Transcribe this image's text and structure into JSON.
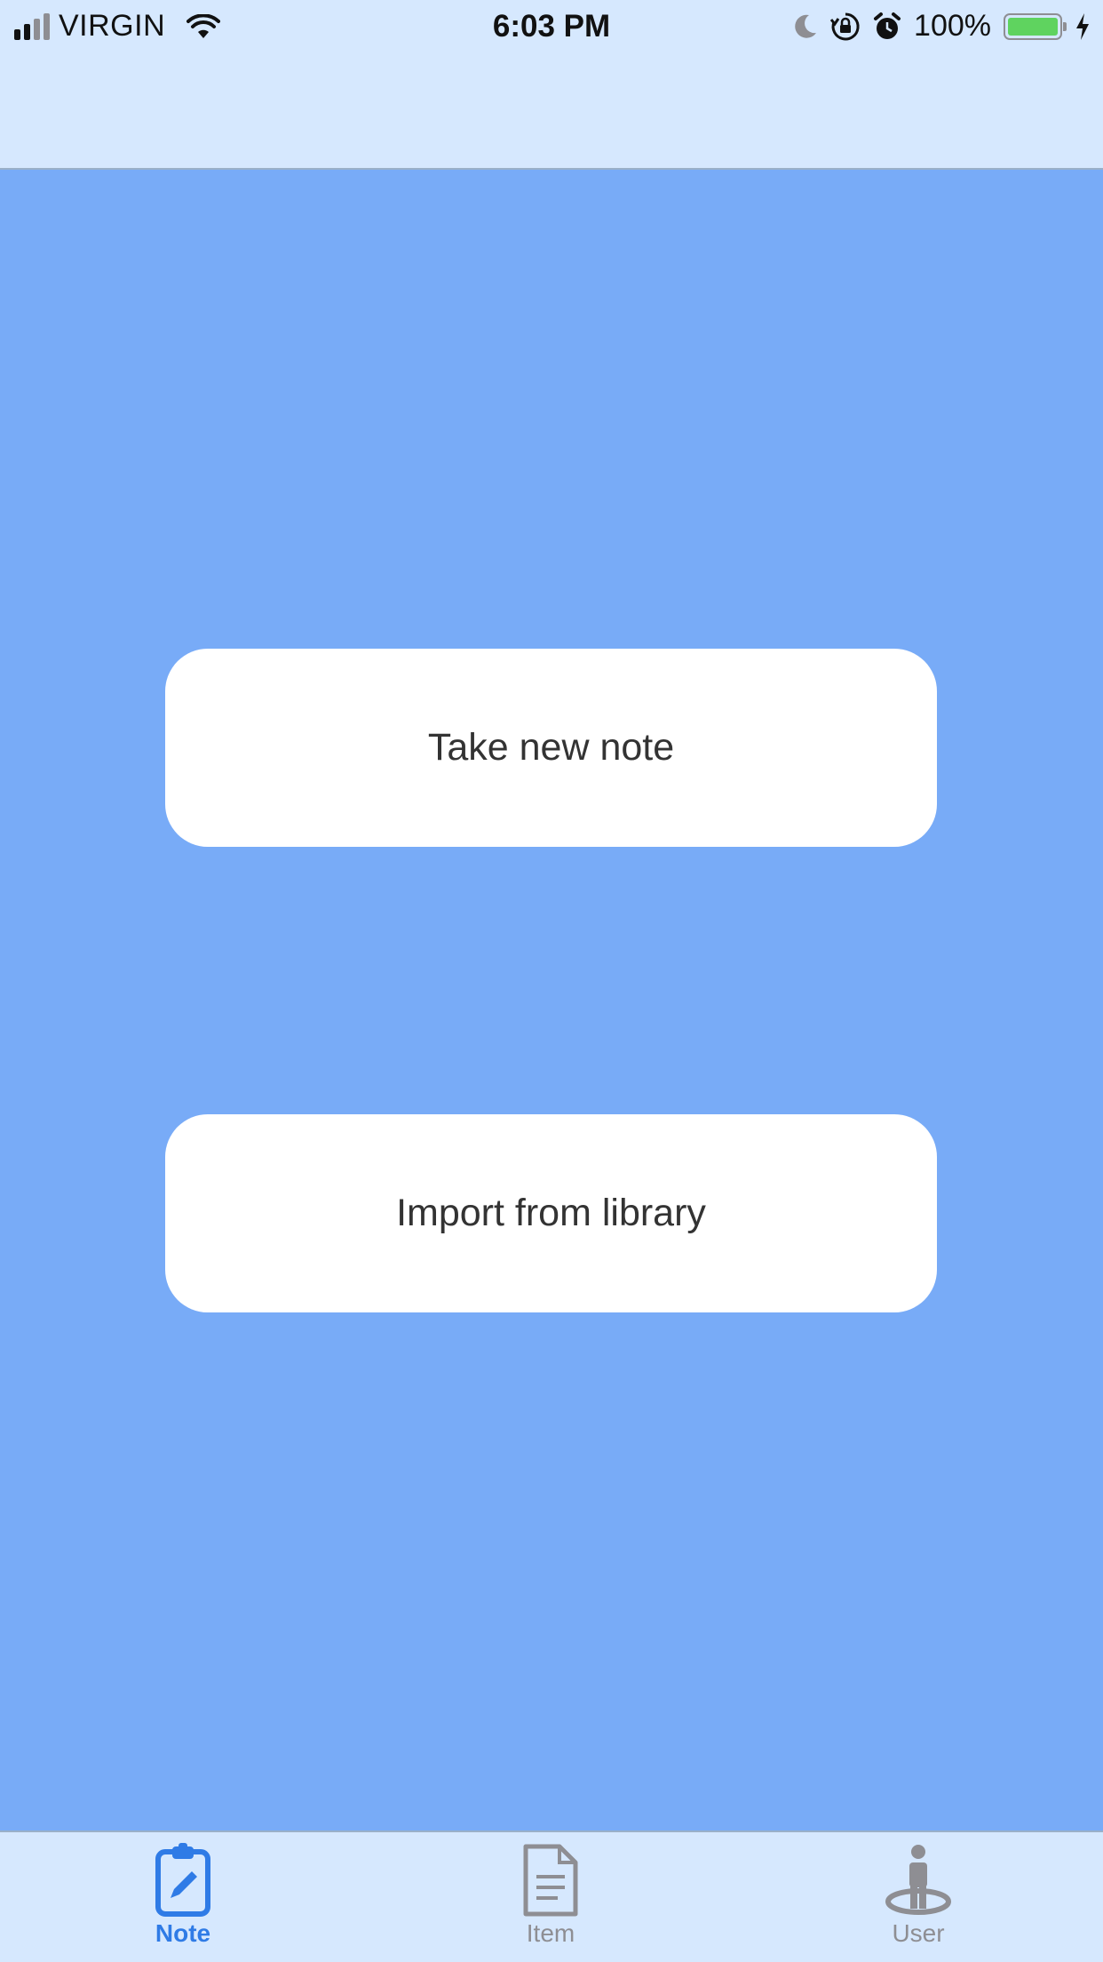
{
  "status_bar": {
    "carrier": "VIRGIN",
    "time": "6:03 PM",
    "battery_percent": "100%",
    "icons": [
      "signal-icon",
      "wifi-icon",
      "moon-icon",
      "orientation-lock-icon",
      "alarm-icon",
      "battery-icon",
      "charging-icon"
    ]
  },
  "main": {
    "take_note_label": "Take new note",
    "import_label": "Import from library"
  },
  "tab_bar": {
    "tabs": [
      {
        "label": "Note",
        "icon": "clipboard-pencil-icon",
        "active": true
      },
      {
        "label": "Item",
        "icon": "document-icon",
        "active": false
      },
      {
        "label": "User",
        "icon": "user-location-icon",
        "active": false
      }
    ]
  },
  "colors": {
    "header_bg": "#d6e8fe",
    "content_bg": "#78abf7",
    "button_bg": "#ffffff",
    "active_tab": "#2f7be6",
    "inactive_tab": "#8e8e93"
  }
}
